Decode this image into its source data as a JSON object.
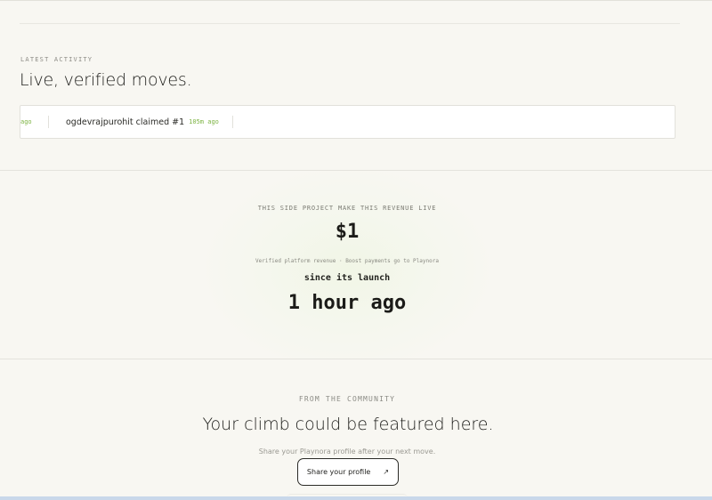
{
  "activity": {
    "eyebrow": "LATEST ACTIVITY",
    "heading": "Live, verified moves.",
    "ticker": [
      {
        "user": "",
        "time": "ago"
      },
      {
        "user": "ogdevrajpurohit claimed #1",
        "time": "105m ago"
      }
    ]
  },
  "revenue": {
    "eyebrow": "THIS SIDE PROJECT MAKE THIS REVENUE LIVE",
    "amount": "$1",
    "note": "Verified platform revenue · Boost payments go to Playnora",
    "since_label": "since its launch",
    "time_ago": "1 hour ago"
  },
  "community": {
    "eyebrow": "FROM THE COMMUNITY",
    "title": "Your climb could be featured here.",
    "subtitle": "Share your Playnora profile after your next move.",
    "share_button": "Share your profile",
    "share_icon": "arrow-up-right-icon",
    "share_glyph": "↗"
  },
  "colors": {
    "background": "#f8f7f2",
    "accent_green": "#7cb342",
    "text": "#1f1f1c"
  }
}
